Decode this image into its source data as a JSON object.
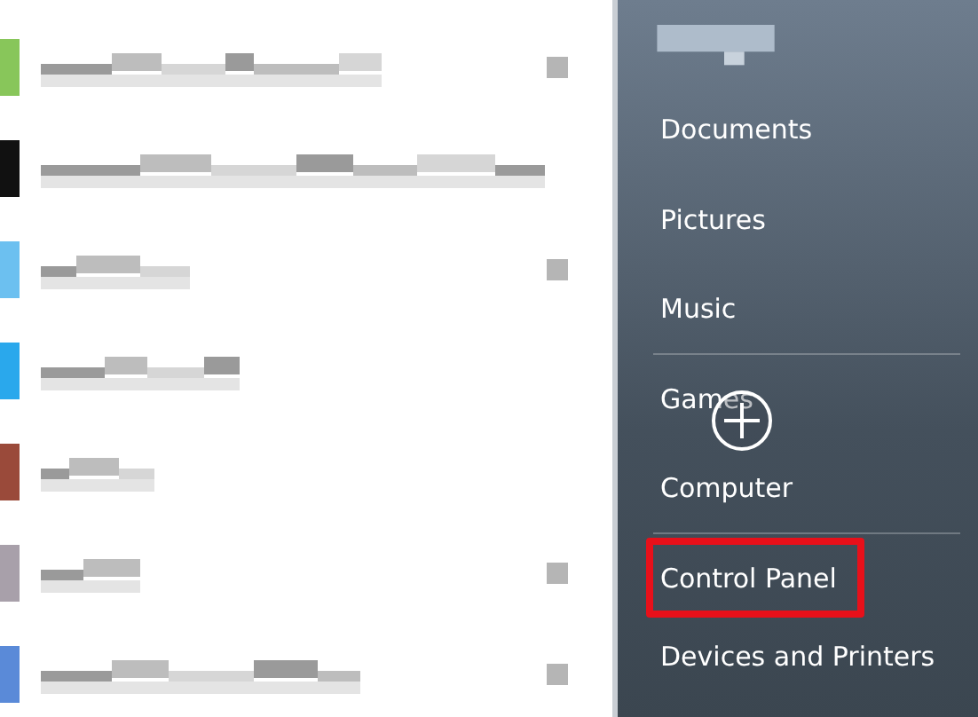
{
  "programs": [
    {
      "color": "#88c65a",
      "submenu": true
    },
    {
      "color": "#111111",
      "submenu": false
    },
    {
      "color": "#6cc0f0",
      "submenu": true
    },
    {
      "color": "#2aa8ec",
      "submenu": false
    },
    {
      "color": "#9a4a3a",
      "submenu": false
    },
    {
      "color": "#a8a0aa",
      "submenu": true
    },
    {
      "color": "#5a8ad8",
      "submenu": true
    }
  ],
  "places": [
    {
      "label": "Documents",
      "highlighted": false,
      "separator_after": false
    },
    {
      "label": "Pictures",
      "highlighted": false,
      "separator_after": false
    },
    {
      "label": "Music",
      "highlighted": false,
      "separator_after": true
    },
    {
      "label": "Games",
      "highlighted": false,
      "separator_after": false
    },
    {
      "label": "Computer",
      "highlighted": false,
      "separator_after": true
    },
    {
      "label": "Control Panel",
      "highlighted": true,
      "separator_after": false
    },
    {
      "label": "Devices and Printers",
      "highlighted": false,
      "separator_after": false
    }
  ]
}
